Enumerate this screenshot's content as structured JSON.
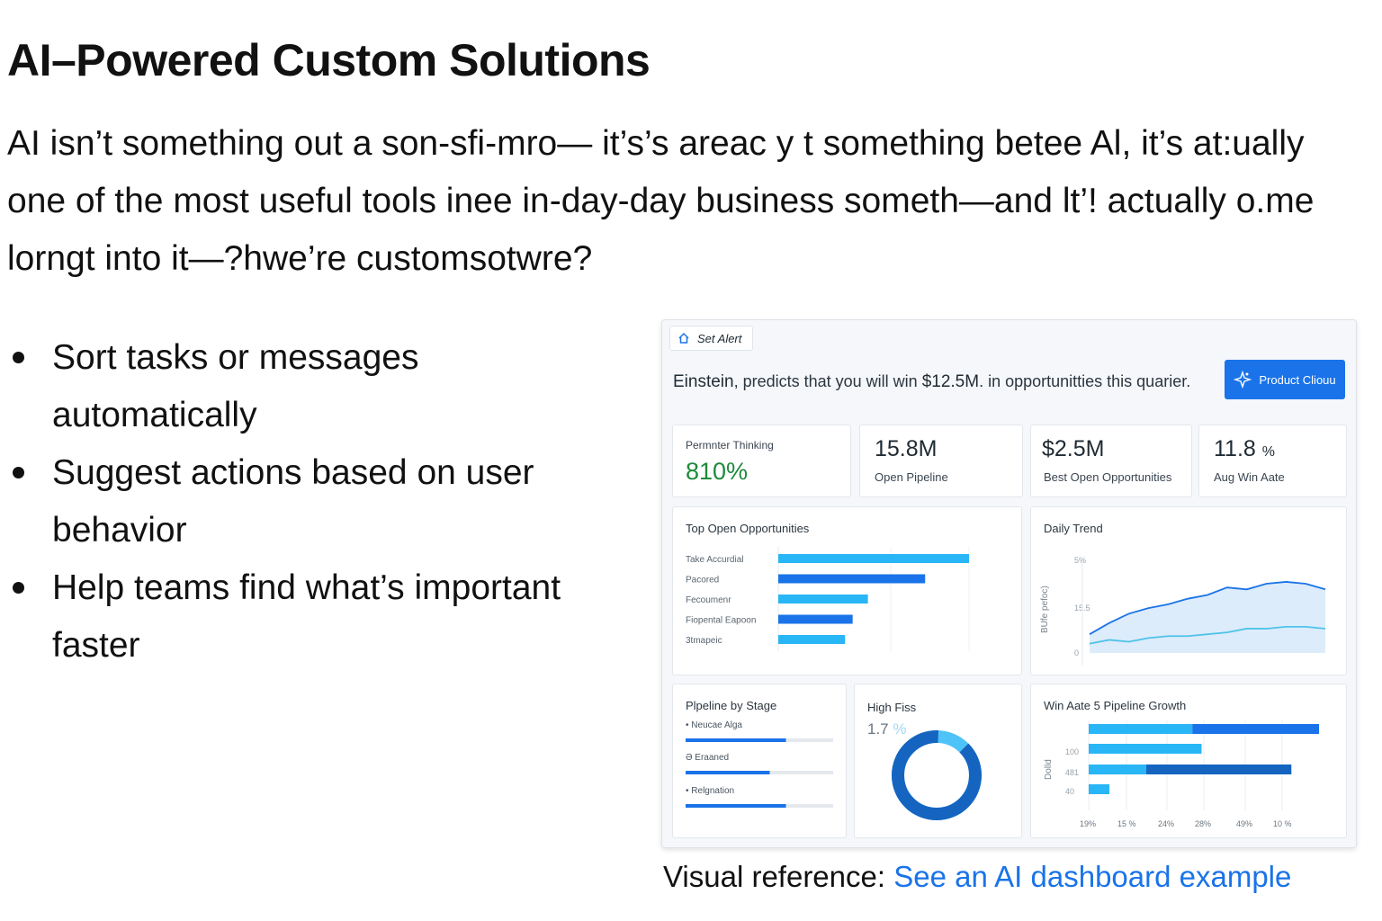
{
  "page": {
    "title": "AI–Powered Custom Solutions",
    "intro": "AI isn’t something out a son-sfi-mro— it’s’s areac y t something betee Al, it’s at:ually one of the most useful tools inee in-day-day business someth—and lt’! actually o.me lorngt into it—?hwe’re customsotwre?",
    "bullets": [
      "Sort tasks or messages automatically",
      "Suggest actions based on user behavior",
      "Help teams find what’s important faster"
    ],
    "visual_ref_label": "Visual reference:",
    "visual_ref_link": "See an AI dashboard example"
  },
  "dashboard": {
    "set_alert_label": "Set Alert",
    "headline_prefix": "Einstein",
    "headline_mid": ", predicts that you will win ",
    "headline_amount": "$12.5M",
    "headline_suffix": ".  in opportunitties this quarier.",
    "product_button": "Product Cliouu",
    "kpis": [
      {
        "label": "Permnter Thinking",
        "value": "810%"
      },
      {
        "label": "Open Pipeline",
        "value": "15.8M"
      },
      {
        "label": "Best Open Opportunities",
        "value": "$2.5M"
      },
      {
        "label": "Aug Win Aate",
        "value": "11.8",
        "unit": "%"
      }
    ],
    "colors": {
      "primary": "#1a73e8",
      "light": "#29b6f6",
      "dark": "#1565c0",
      "green": "#1e8a3a"
    }
  },
  "chart_data": [
    {
      "type": "bar",
      "title": "Top Open Opportunities",
      "categories": [
        "Take Accurdial",
        "Pacored",
        "Fecoumenr",
        "Fiopental Eapoon",
        "3tmapeic"
      ],
      "values": [
        100,
        77,
        47,
        39,
        35
      ]
    },
    {
      "type": "line",
      "title": "Daily Trend",
      "ylabel": "BUfe  pefoc)",
      "ytick_labels": [
        "5%",
        "15.5",
        "0"
      ],
      "series": [
        {
          "values": [
            10,
            16,
            21,
            24,
            26,
            29,
            31,
            35,
            34,
            37,
            38,
            37,
            34
          ]
        },
        {
          "values": [
            5,
            7,
            6,
            8,
            9,
            9,
            10,
            11,
            13,
            13,
            14,
            14,
            13
          ]
        }
      ]
    },
    {
      "type": "bar",
      "title": "Plpeline by Stage",
      "categories": [
        "• Neucae Alga",
        "Ə Eraaned",
        "• Relgnation"
      ],
      "values": [
        68,
        57,
        68
      ]
    },
    {
      "type": "pie",
      "title": "High Fiss",
      "value_label": "1.7",
      "unit": "%",
      "values": [
        88,
        12
      ]
    },
    {
      "type": "bar",
      "title": "Win Aate 5 Pipeline Growth",
      "ylabel": "Dolld",
      "ytick_labels": [
        "100",
        "481",
        "40"
      ],
      "xtick_labels": [
        "19%",
        "15 %",
        "24%",
        "28%",
        "49%",
        "10 %"
      ],
      "series": [
        {
          "name": "",
          "values": [
            45,
            49,
            25,
            9
          ]
        },
        {
          "name": "",
          "values": [
            100,
            0,
            88,
            0
          ]
        }
      ]
    }
  ]
}
